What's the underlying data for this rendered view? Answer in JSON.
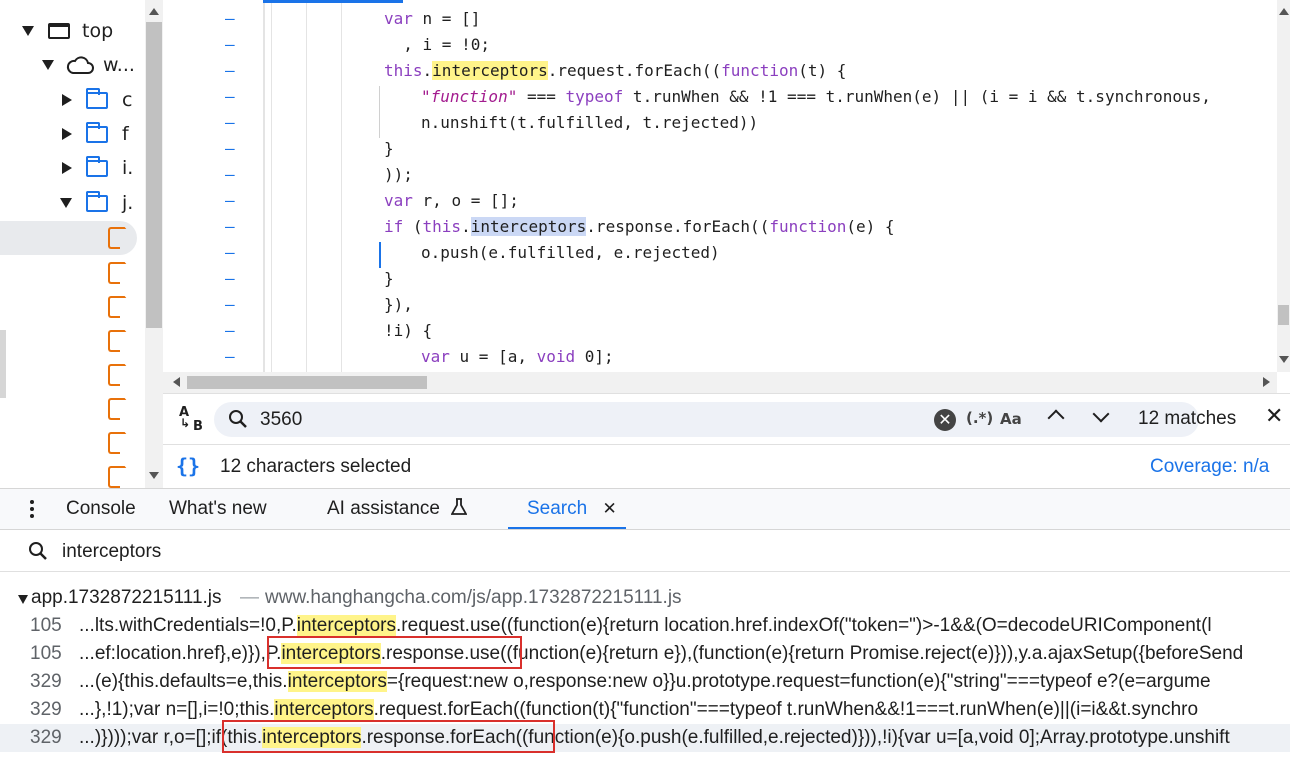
{
  "tree": {
    "items": [
      {
        "label": "top",
        "kind": "window",
        "expanded": true
      },
      {
        "label": "w...",
        "kind": "cloud",
        "expanded": true
      },
      {
        "label": "c",
        "kind": "folder",
        "expanded": false
      },
      {
        "label": "f",
        "kind": "folder",
        "expanded": false
      },
      {
        "label": "i.",
        "kind": "folder",
        "expanded": false
      },
      {
        "label": "j.",
        "kind": "folder",
        "expanded": true
      }
    ],
    "file_count": 8
  },
  "editor": {
    "lines": [
      {
        "gutter": "–",
        "parts": [
          [
            "kw",
            "var"
          ],
          [
            "t",
            " n = []"
          ]
        ],
        "indent": 0
      },
      {
        "gutter": "–",
        "parts": [
          [
            "t",
            "  , i = !0;"
          ]
        ],
        "indent": 0
      },
      {
        "gutter": "–",
        "parts": [
          [
            "kw",
            "this"
          ],
          [
            "t",
            "."
          ],
          [
            "hl",
            "interceptors"
          ],
          [
            "t",
            ".request.forEach(("
          ],
          [
            "kw",
            "function"
          ],
          [
            "t",
            "(t) {"
          ]
        ],
        "indent": 0
      },
      {
        "gutter": "–",
        "parts": [
          [
            "str",
            "\"function\""
          ],
          [
            "t",
            " === "
          ],
          [
            "kw",
            "typeof"
          ],
          [
            "t",
            " t.runWhen && !1 === t.runWhen(e) || (i = i && t.synchronous,"
          ]
        ],
        "indent": 1
      },
      {
        "gutter": "–",
        "parts": [
          [
            "t",
            "n.unshift(t.fulfilled, t.rejected))"
          ]
        ],
        "indent": 1
      },
      {
        "gutter": "–",
        "parts": [
          [
            "t",
            "}"
          ]
        ],
        "indent": 0
      },
      {
        "gutter": "–",
        "parts": [
          [
            "t",
            "));"
          ]
        ],
        "indent": 0
      },
      {
        "gutter": "–",
        "parts": [
          [
            "kw",
            "var"
          ],
          [
            "t",
            " r, o = [];"
          ]
        ],
        "indent": 0
      },
      {
        "gutter": "–",
        "parts": [
          [
            "kw",
            "if"
          ],
          [
            "t",
            " ("
          ],
          [
            "kw",
            "this"
          ],
          [
            "t",
            "."
          ],
          [
            "sel",
            "interceptors"
          ],
          [
            "t",
            ".response.forEach(("
          ],
          [
            "kw",
            "function"
          ],
          [
            "t",
            "(e) {"
          ]
        ],
        "indent": 0
      },
      {
        "gutter": "–",
        "parts": [
          [
            "t",
            "o.push(e.fulfilled, e.rejected)"
          ]
        ],
        "indent": 1
      },
      {
        "gutter": "–",
        "parts": [
          [
            "t",
            "}"
          ]
        ],
        "indent": 0
      },
      {
        "gutter": "–",
        "parts": [
          [
            "t",
            "}),"
          ]
        ],
        "indent": 0
      },
      {
        "gutter": "–",
        "parts": [
          [
            "t",
            "!i) {"
          ]
        ],
        "indent": 0
      },
      {
        "gutter": "–",
        "parts": [
          [
            "kw",
            "var"
          ],
          [
            "t",
            " u = [a, "
          ],
          [
            "kw",
            "void"
          ],
          [
            "t",
            " 0];"
          ]
        ],
        "indent": 1
      }
    ]
  },
  "findbar": {
    "query": "3560",
    "regex_label": "(.*)",
    "case_label": "Aa",
    "matches": "12 matches"
  },
  "status": {
    "selection": "12 characters selected",
    "coverage": "Coverage: n/a"
  },
  "drawer": {
    "tabs": [
      "Console",
      "What's new",
      "AI assistance",
      "Search"
    ],
    "active_tab": "Search"
  },
  "search": {
    "query": "interceptors",
    "file": "app.1732872215111.js",
    "url": "www.hanghangcha.com/js/app.1732872215111.js",
    "results": [
      {
        "line": "105",
        "pre": "...lts.withCredentials=!0,P.",
        "match": "interceptors",
        "post": ".request.use((function(e){return location.href.indexOf(\"token=\")>-1&&(O=decodeURIComponent(l"
      },
      {
        "line": "105",
        "pre": "...ef:location.href},e)}),P.",
        "match": "interceptors",
        "post": ".response.use((function(e){return e}),(function(e){return Promise.reject(e)})),y.a.ajaxSetup({beforeSend"
      },
      {
        "line": "329",
        "pre": "...(e){this.defaults=e,this.",
        "match": "interceptors",
        "post": "={request:new o,response:new o}}u.prototype.request=function(e){\"string\"===typeof e?(e=argume"
      },
      {
        "line": "329",
        "pre": "...},!1);var n=[],i=!0;this.",
        "match": "interceptors",
        "post": ".request.forEach((function(t){\"function\"===typeof t.runWhen&&!1===t.runWhen(e)||(i=i&&t.synchro"
      },
      {
        "line": "329",
        "pre": "...)})));var r,o=[];if(this.",
        "match": "interceptors",
        "post": ".response.forEach((function(e){o.push(e.fulfilled,e.rejected)})),!i){var u=[a,void 0];Array.prototype.unshift"
      }
    ]
  }
}
